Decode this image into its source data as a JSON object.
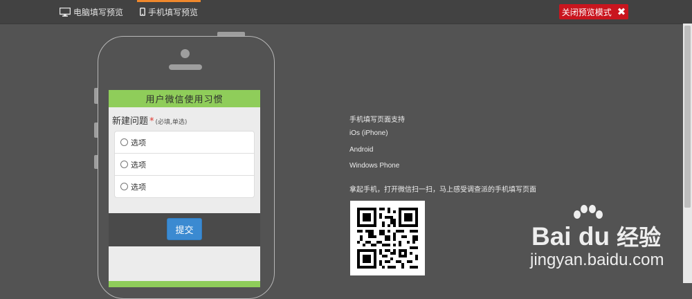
{
  "topbar": {
    "tab_desktop": "电脑填写预览",
    "tab_mobile": "手机填写预览",
    "close_label": "关闭预览模式",
    "close_icon": "close-icon"
  },
  "survey": {
    "title": "用户微信使用习惯",
    "question": "新建问题",
    "required_mark": "*",
    "hint": "(必填,单选)",
    "options": [
      "选项",
      "选项",
      "选项"
    ],
    "submit_label": "提交"
  },
  "info": {
    "heading": "手机填写页面支持",
    "platforms": [
      "iOs (iPhone)",
      "Android",
      "Windows Phone"
    ],
    "scan_text": "拿起手机，打开微信扫一扫，马上感受调查派的手机填写页面"
  },
  "watermark": {
    "brand": "Bai du",
    "brand_cn": "经验",
    "url": "jingyan.baidu.com"
  },
  "colors": {
    "background": "#535353",
    "topbar": "#424242",
    "tab_accent": "#f0882c",
    "close_button": "#c9151e",
    "survey_header": "#8fcd5a",
    "submit_button": "#3b8ad1"
  }
}
